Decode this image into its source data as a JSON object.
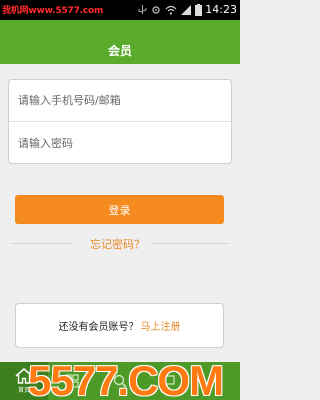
{
  "status_bar": {
    "site_label": "我机网",
    "site_url": "www.5577.com",
    "time": "14:23",
    "icons": [
      "usb-icon",
      "settings-icon",
      "wifi-icon",
      "signal-icon",
      "battery-icon"
    ]
  },
  "header": {
    "title": "会员"
  },
  "login_form": {
    "account_placeholder": "请输入手机号码/邮箱",
    "password_placeholder": "请输入密码",
    "login_label": "登录",
    "forgot_label": "忘记密码？"
  },
  "register": {
    "prompt": "还没有会员账号？",
    "link": "马上注册"
  },
  "tab_bar": {
    "items": [
      {
        "label": "首页",
        "icon": "home-icon",
        "active": true
      },
      {
        "label": "",
        "icon": "category-icon",
        "active": false
      },
      {
        "label": "",
        "icon": "search-icon",
        "active": false
      },
      {
        "label": "",
        "icon": "chat-icon",
        "active": false
      },
      {
        "label": "",
        "icon": "more-icon",
        "active": false
      }
    ]
  },
  "watermark": {
    "text": "5577.COM"
  },
  "colors": {
    "header_green": "#5aaa2c",
    "tab_green": "#4d9a28",
    "accent_orange": "#f58a1f",
    "link_orange": "#e68a26"
  }
}
